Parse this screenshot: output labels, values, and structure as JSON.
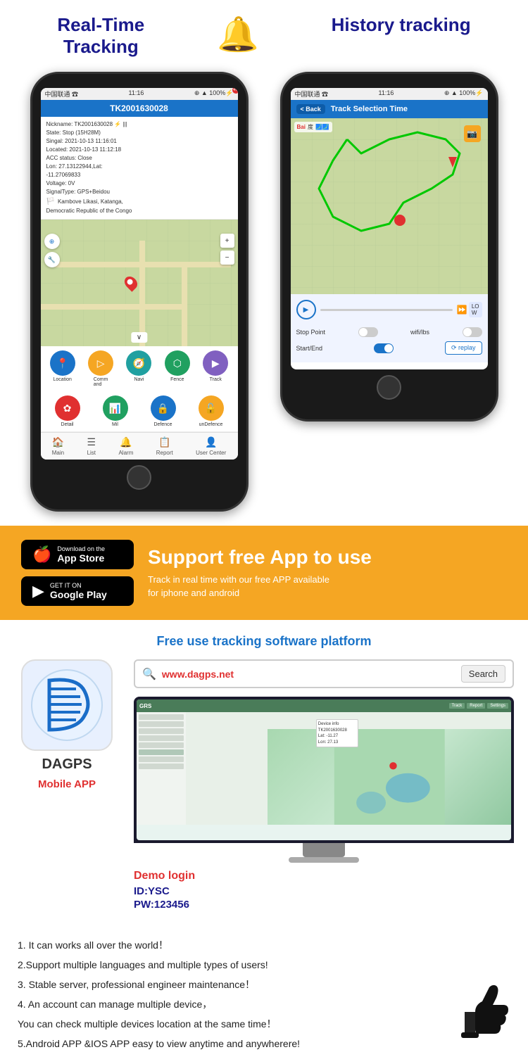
{
  "header": {
    "title_left": "Real-Time\nTracking",
    "title_right": "History tracking"
  },
  "phone_left": {
    "status_bar": "中国联通 ☎ 11:16  ⊕ ▲ 100% ⚡",
    "title": "TK2001630028",
    "info_lines": [
      "Nickname: TK2001630028 ⚡ ▲▲▲",
      "State: Stop (15H28M)",
      "Singal: 2021-10-13 11:16:01",
      "Located: 2021-10-13 11:12:18",
      "ACC Status: Close",
      "Lon: 27.13122944,Lat:",
      "-11.27069833",
      "Voltage: 0V",
      "SignalType: GPS+Beidou",
      "Kambove Likasi, Katanga,",
      "Democratic Republic of the Congo"
    ],
    "nav_items": [
      "Main",
      "List",
      "Alarm",
      "Report",
      "User Center"
    ],
    "action_buttons_row1": [
      "Location",
      "Command",
      "Navi",
      "Fence",
      "Track"
    ],
    "action_buttons_row2": [
      "Detail",
      "Mil",
      "Defence",
      "unDefence"
    ]
  },
  "phone_right": {
    "back_label": "< Back",
    "title": "Track Selection Time",
    "stop_point": "Stop Point",
    "wifi_lbs": "wifi/lbs",
    "start_end": "Start/End",
    "replay": "⟳ replay",
    "speed": "LO\nW"
  },
  "yellow_section": {
    "app_store_small": "Download on the",
    "app_store_large": "App Store",
    "google_play_small": "GET IT ON",
    "google_play_large": "Google Play",
    "support_title": "Support free App to use",
    "support_subtitle": "Track in real time with our free APP available\nfor iphone and android"
  },
  "platform_section": {
    "title": "Free use tracking software platform",
    "search_url": "www.dagps.net",
    "search_button": "Search",
    "app_name": "DAGPS",
    "mobile_app_label": "Mobile APP",
    "demo_login": "Demo login",
    "demo_id": "ID:YSC",
    "demo_pw": "PW:123456"
  },
  "features": {
    "items": [
      "1. It can works all over the world！",
      "2.Support multiple languages and multiple types of users!",
      "3. Stable server, professional engineer maintenance！",
      "4. An account can manage multiple device，",
      "You can check multiple devices location at the same time！",
      "5.Android APP &IOS APP easy to view anytime and anywherere!"
    ]
  }
}
